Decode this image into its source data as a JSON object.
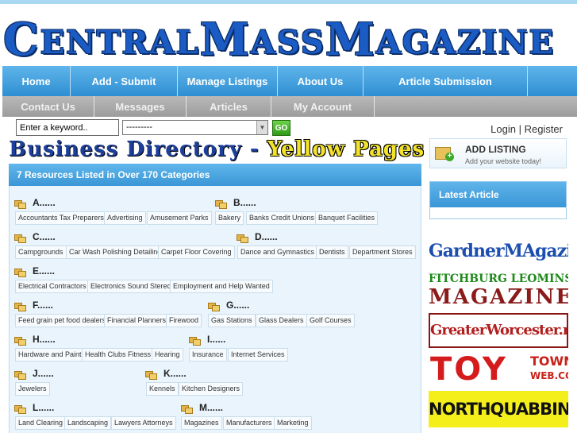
{
  "logo": {
    "c1": "C",
    "r1": "ENTRAL",
    "c2": "M",
    "r2": "ASS",
    "c3": "M",
    "r3": "AGAZINE"
  },
  "nav_primary": [
    "Home",
    "Add - Submit",
    "Manage Listings",
    "About Us",
    "Article Submission"
  ],
  "nav_secondary": [
    "Contact Us",
    "Messages",
    "Articles",
    "My Account"
  ],
  "search": {
    "keyword_placeholder": "Enter a keyword..",
    "category_value": "---------",
    "go_label": "GO"
  },
  "auth": {
    "login": "Login",
    "separator": "|",
    "register": "Register"
  },
  "banner": {
    "part1": "Business Directory - ",
    "part2": "Yellow Pages"
  },
  "directory": {
    "header": "7 Resources Listed in Over 170 Categories",
    "letters": {
      "a": "A......",
      "b": "B......",
      "c": "C......",
      "d": "D......",
      "e": "E......",
      "f": "F......",
      "g": "G......",
      "h": "H......",
      "i": "I......",
      "j": "J......",
      "k": "K......",
      "l": "L......",
      "m": "M......"
    },
    "categories": {
      "a": [
        "Accountants Tax Preparers",
        "Advertising",
        "Amusement Parks"
      ],
      "b": [
        "Bakery",
        "Banks Credit Unions",
        "Banquet Facilities"
      ],
      "c": [
        "Campgrounds",
        "Car Wash Polishing Detailing",
        "Carpet Floor Covering"
      ],
      "d": [
        "Dance and Gymnastics",
        "Dentists",
        "Department Stores"
      ],
      "e": [
        "Electrical Contractors",
        "Electronics Sound Stereo",
        "Employment and Help Wanted"
      ],
      "f": [
        "Feed grain pet food dealers",
        "Financial Planners",
        "Firewood"
      ],
      "g": [
        "Gas Stations",
        "Glass Dealers",
        "Golf Courses"
      ],
      "h": [
        "Hardware and Paint",
        "Health Clubs Fitness",
        "Hearing"
      ],
      "i": [
        "Insurance",
        "Internet Services"
      ],
      "j": [
        "Jewelers"
      ],
      "k": [
        "Kennels",
        "Kitchen Designers"
      ],
      "l": [
        "Land Clearing",
        "Landscaping",
        "Lawyers Attorneys"
      ],
      "m": [
        "Magazines",
        "Manufacturers",
        "Marketing"
      ]
    }
  },
  "sidebar": {
    "add_listing_title": "ADD LISTING",
    "add_listing_sub": "Add your website today!",
    "latest_article": "Latest Article"
  },
  "ads": {
    "gardner": "GardnerMAgazine",
    "fitchburg": "FITCHBURG LEOMINSTER",
    "fitchburg_mag": "MAGAZINE",
    "worcester": "GreaterWorcester.net",
    "toy": "TOY",
    "toy_town": "TOWN",
    "toy_web": "WEB.COM",
    "quabbin": "NORTHQUABBIN.COM"
  },
  "colors": {
    "nav_blue": "#3a96d6",
    "nav_gray": "#a5a5a5",
    "panel_bg": "#e9f4fc",
    "logo_blue": "#1b5bc4"
  }
}
